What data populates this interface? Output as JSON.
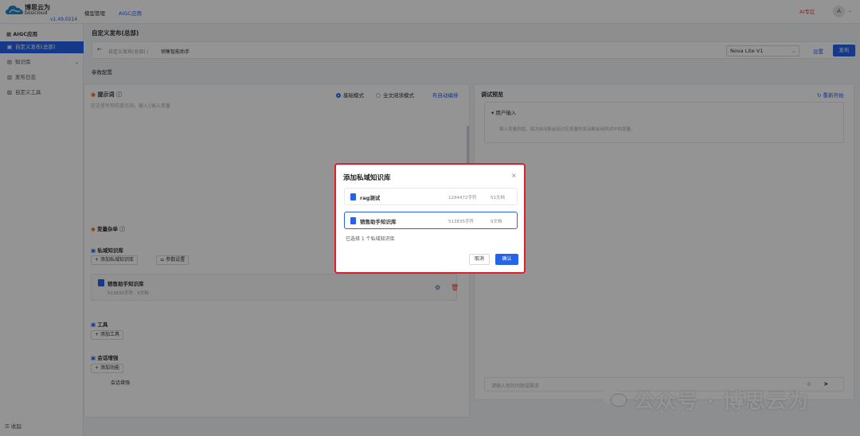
{
  "app": {
    "name_cn": "博思云为",
    "name_en": "bosicloud",
    "version": "v1.49.0214"
  },
  "topnav": {
    "items": [
      "模型管理",
      "AIGC应用"
    ],
    "ai_zone": "AI专区",
    "avatar": "A"
  },
  "sidebar": {
    "header": "AIGC应用",
    "items": [
      {
        "label": "自定义发布(总部)",
        "icon": "app-icon"
      },
      {
        "label": "知识库",
        "icon": "book-icon"
      },
      {
        "label": "发布日志",
        "icon": "log-icon"
      },
      {
        "label": "自定义工具",
        "icon": "toolbox-icon"
      }
    ],
    "collapse": "收起"
  },
  "page": {
    "title": "自定义发布(总部)",
    "breadcrumb": [
      "自定义发布(总部) /",
      "销售智能助手"
    ],
    "model": "Nova Lite V1",
    "settings": "设置",
    "publish": "发布",
    "tab": "参数配置"
  },
  "prompt": {
    "title": "提示词",
    "mode_basic": "基础模式",
    "mode_full": "全文阅读模式",
    "autogen": "布自动编排",
    "placeholder": "在这里写你的提示词，输入{插入变量"
  },
  "vars": {
    "title": "变量杂单",
    "kb_section": "私域知识库",
    "add_kb": "添加私域知识库",
    "param_settings": "参数设置",
    "kb_card": {
      "name": "销售助手知识库",
      "meta": "513835字符 · 9文档"
    },
    "tools_section": "工具",
    "add_tool": "添加工具",
    "session_section": "会话增强",
    "add_feature": "添加功能",
    "session_item": "会话增强"
  },
  "debug": {
    "title": "调试预览",
    "restart": "重新开始",
    "user_input": "用户输入",
    "user_hint": "填入变量的值，每次启动新会话对应变量的变动都会用到对中的变量。",
    "chat_placeholder": "请输入你的问题或需求",
    "chat_count": "0"
  },
  "watermark": "公众号 · 博思云为",
  "modal": {
    "title": "添加私域知识库",
    "options": [
      {
        "name": "rag测试",
        "chars": "1294472字符",
        "docs": "51文档",
        "selected": false
      },
      {
        "name": "销售助手知识库",
        "chars": "513835字符",
        "docs": "9文档",
        "selected": true
      }
    ],
    "selected_count": "已选择 1 个私域知识库",
    "cancel": "取消",
    "ok": "确认"
  },
  "colors": {
    "accent": "#2563eb",
    "danger": "#e11d2e",
    "ai_zone": "#ef4444"
  }
}
